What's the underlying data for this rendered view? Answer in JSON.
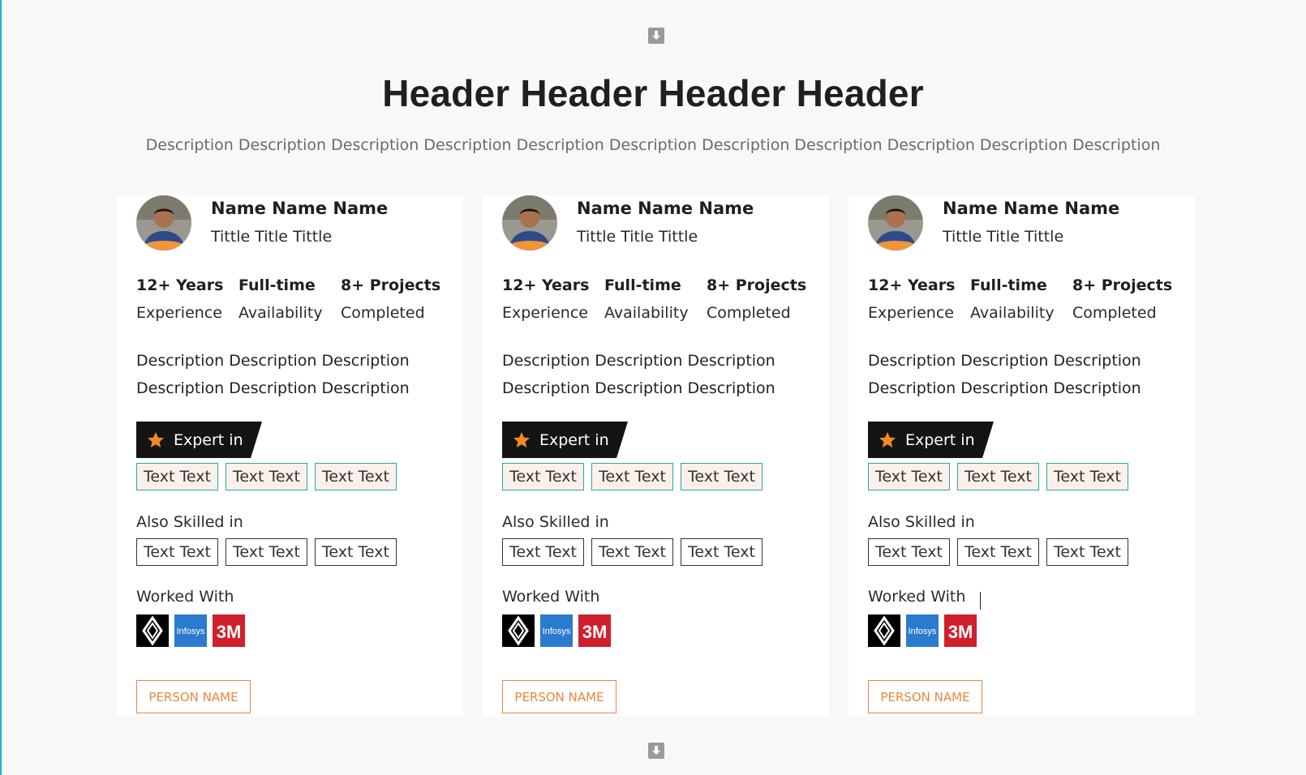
{
  "header": {
    "title": "Header Header Header Header",
    "description": "Description Description Description Description Description Description Description Description Description Description Description"
  },
  "colors": {
    "accent": "#e8873d",
    "edge": "#1fb3c9",
    "expert_tag_border": "#2aa7a0",
    "expert_banner": "#141414",
    "star": "#f08a24"
  },
  "cards": [
    {
      "name": "Name Name Name",
      "title": "Tittle Title Tittle",
      "stats": [
        {
          "value": "12+ Years",
          "label": "Experience"
        },
        {
          "value": "Full-time",
          "label": "Availability"
        },
        {
          "value": "8+ Projects",
          "label": "Completed"
        }
      ],
      "description": [
        "Description Description Description",
        "Description Description Description"
      ],
      "expert_label": "Expert in",
      "expert_tags": [
        "Text Text",
        "Text Text",
        "Text Text"
      ],
      "also_label": "Also Skilled in",
      "skilled_tags": [
        "Text Text",
        "Text Text",
        "Text Text"
      ],
      "worked_label": "Worked With",
      "logos": [
        "renault-logo",
        "infosys-logo",
        "3m-logo"
      ],
      "button": "PERSON NAME"
    },
    {
      "name": "Name Name Name",
      "title": "Tittle Title Tittle",
      "stats": [
        {
          "value": "12+ Years",
          "label": "Experience"
        },
        {
          "value": "Full-time",
          "label": "Availability"
        },
        {
          "value": "8+ Projects",
          "label": "Completed"
        }
      ],
      "description": [
        "Description Description Description",
        "Description Description Description"
      ],
      "expert_label": "Expert in",
      "expert_tags": [
        "Text Text",
        "Text Text",
        "Text Text"
      ],
      "also_label": "Also Skilled in",
      "skilled_tags": [
        "Text Text",
        "Text Text",
        "Text Text"
      ],
      "worked_label": "Worked With",
      "logos": [
        "renault-logo",
        "infosys-logo",
        "3m-logo"
      ],
      "button": "PERSON NAME"
    },
    {
      "name": "Name Name Name",
      "title": "Tittle Title Tittle",
      "stats": [
        {
          "value": "12+ Years",
          "label": "Experience"
        },
        {
          "value": "Full-time",
          "label": "Availability"
        },
        {
          "value": "8+ Projects",
          "label": "Completed"
        }
      ],
      "description": [
        "Description Description Description",
        "Description Description Description"
      ],
      "expert_label": "Expert in",
      "expert_tags": [
        "Text Text",
        "Text Text",
        "Text Text"
      ],
      "also_label": "Also Skilled in",
      "skilled_tags": [
        "Text Text",
        "Text Text",
        "Text Text"
      ],
      "worked_label": "Worked With",
      "logos": [
        "renault-logo",
        "infosys-logo",
        "3m-logo"
      ],
      "button": "PERSON NAME"
    }
  ]
}
